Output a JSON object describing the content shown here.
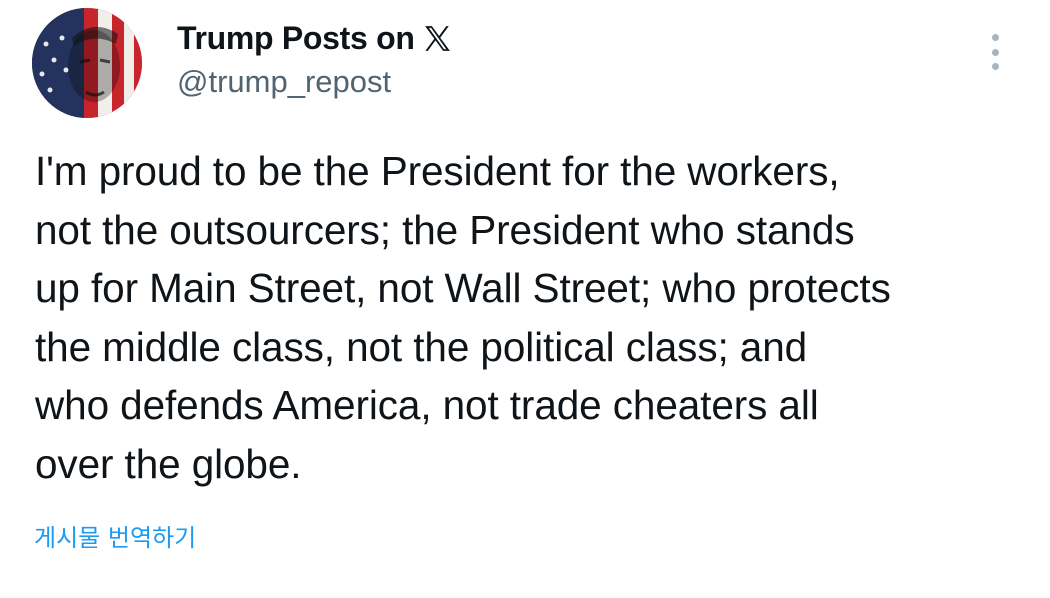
{
  "post": {
    "author": {
      "display_name": "Trump Posts on",
      "handle": "@trump_repost",
      "avatar": "flag-portrait-avatar",
      "badge_icon": "x-logo-icon"
    },
    "more_icon": "more-vertical-icon",
    "text": "I'm proud to be the President for the workers,\nnot the outsourcers; the President who stands\nup for Main Street, not Wall Street; who protects\nthe middle class, not the political class; and\nwho defends America, not trade cheaters all\nover the globe.",
    "translate_label": "게시물 번역하기"
  },
  "colors": {
    "text_primary": "#0f1419",
    "text_secondary": "#536471",
    "link": "#1d9bf0",
    "more_dots": "#a9b4bc"
  }
}
